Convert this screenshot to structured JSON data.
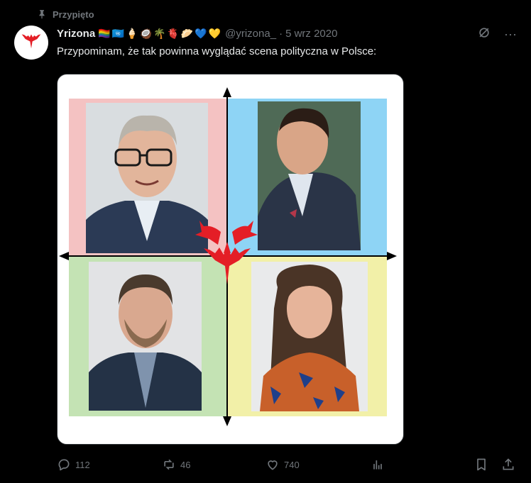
{
  "pinned": {
    "label": "Przypięto",
    "icon": "pin-icon"
  },
  "author": {
    "name": "Yrizona",
    "emojis": [
      "🏳️‍🌈",
      "🇺🇳",
      "🍦",
      "🥥",
      "🌴",
      "🫀",
      "🥟",
      "💙",
      "💛"
    ],
    "handle": "@yrizona_",
    "separator": "·",
    "date": "5 wrz 2020",
    "avatar_icon": "red-dragon-logo"
  },
  "tweet": {
    "text": "Przypominam, że tak powinna wyglądać scena polityczna w Polsce:"
  },
  "header_icons": {
    "grok": "grok-icon",
    "more": "···"
  },
  "media": {
    "colors": {
      "top_left": "#f4c2c2",
      "top_right": "#8ed4f5",
      "bottom_left": "#c4e3b4",
      "bottom_right": "#f2f0a8",
      "dragon": "#e41e26"
    }
  },
  "actions": {
    "replies": "112",
    "reposts": "46",
    "likes": "740"
  }
}
